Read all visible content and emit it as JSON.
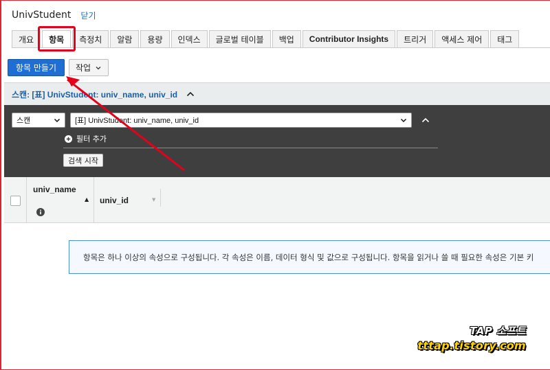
{
  "header": {
    "table_name": "UnivStudent",
    "close_label": "닫기"
  },
  "tabs": [
    {
      "label": "개요"
    },
    {
      "label": "항목"
    },
    {
      "label": "측정치"
    },
    {
      "label": "알람"
    },
    {
      "label": "용량"
    },
    {
      "label": "인덱스"
    },
    {
      "label": "글로벌 테이블"
    },
    {
      "label": "백업"
    },
    {
      "label": "Contributor Insights"
    },
    {
      "label": "트리거"
    },
    {
      "label": "액세스 제어"
    },
    {
      "label": "태그"
    }
  ],
  "active_tab": "항목",
  "actions": {
    "create_item_label": "항목 만들기",
    "actions_label": "작업"
  },
  "scan": {
    "header_title": "스캔: [표] UnivStudent: univ_name, univ_id",
    "mode_value": "스캔",
    "index_value": "[표] UnivStudent: univ_name, univ_id",
    "add_filter_label": "필터 추가",
    "start_search_label": "검색 시작"
  },
  "grid": {
    "columns": [
      {
        "label": "univ_name",
        "sort": "ascending",
        "icon": "info-icon"
      },
      {
        "label": "univ_id",
        "sort": "none"
      }
    ]
  },
  "info_message": "항목은 하나 이상의 속성으로 구성됩니다. 각 속성은 이름, 데이터 형식 및 값으로 구성됩니다. 항목을 읽거나 쓸 때 필요한 속성은 기본 키",
  "watermark": {
    "line1": "TAP 소프트",
    "line2": "tttap.tistory.com"
  },
  "colors": {
    "primary": "#1f6ed4",
    "link": "#1a6cc2",
    "annotation_red": "#e5001b",
    "panel_dark": "#3f3f3f",
    "watermark_yellow": "#ffd400"
  }
}
